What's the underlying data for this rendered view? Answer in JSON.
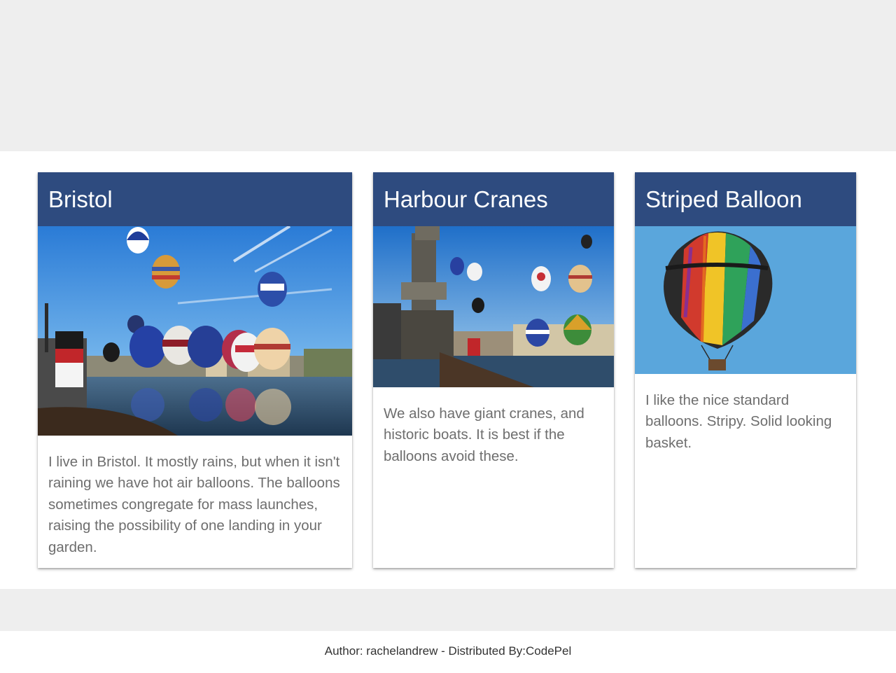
{
  "cards": [
    {
      "title": "Bristol",
      "image": "bristol-harbour-balloons-photo",
      "text": "I live in Bristol. It mostly rains, but when it isn't raining we have hot air balloons. The balloons sometimes congregate for mass launches, raising the possibility of one landing in your garden."
    },
    {
      "title": "Harbour Cranes",
      "image": "harbour-cranes-balloons-photo",
      "text": "We also have giant cranes, and historic boats. It is best if the balloons avoid these."
    },
    {
      "title": "Striped Balloon",
      "image": "striped-balloon-photo",
      "text": "I like the nice standard balloons. Stripy. Solid looking basket."
    }
  ],
  "footer": {
    "text": "Author: rachelandrew - Distributed By:CodePel"
  },
  "colors": {
    "header": "#2e4b7f",
    "page_background": "#eeeeee",
    "content_background": "#ffffff",
    "body_text": "#6e6e6e"
  }
}
